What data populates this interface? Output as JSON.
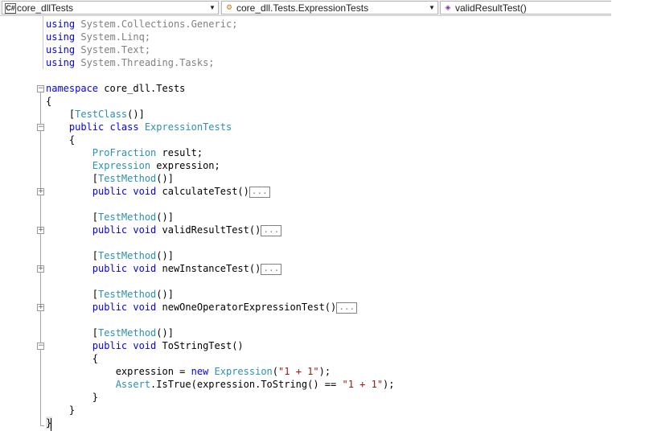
{
  "nav": {
    "project_icon": "C#",
    "project": "core_dllTests",
    "class_name": "core_dll.Tests.ExpressionTests",
    "member": "validResultTest()"
  },
  "code": {
    "using1": "using",
    "using1_ns": " System.Collections.Generic;",
    "using2": "using",
    "using2_ns": " System.Linq;",
    "using3": "using",
    "using3_ns": " System.Text;",
    "using4": "using",
    "using4_ns": " System.Threading.Tasks;",
    "namespace_kw": "namespace",
    "namespace_name": " core_dll.Tests",
    "open_brace": "{",
    "attr_testclass_open": "    [",
    "attr_testclass": "TestClass",
    "attr_testclass_close": "()]",
    "class_public": "    public",
    "class_kw": " class",
    "class_name": " ExpressionTests",
    "class_open": "    {",
    "field1_type": "        ProFraction",
    "field1_name": " result;",
    "field2_type": "        Expression",
    "field2_name": " expression;",
    "attr_open": "        [",
    "attr_testmethod": "TestMethod",
    "attr_close": "()]",
    "m_public": "        public",
    "m_void": " void",
    "m1_name": " calculateTest()",
    "m2_name": " validResultTest()",
    "m3_name": " newInstanceTest()",
    "m4_name": " newOneOperatorExpressionTest()",
    "m5_name": " ToStringTest()",
    "collapsed": "...",
    "m5_open": "        {",
    "stmt1_a": "            expression = ",
    "stmt1_new": "new",
    "stmt1_type": " Expression",
    "stmt1_b": "(",
    "stmt1_str": "\"1 + 1\"",
    "stmt1_c": ");",
    "stmt2_type": "            Assert",
    "stmt2_a": ".IsTrue(expression.ToString() == ",
    "stmt2_str": "\"1 + 1\"",
    "stmt2_c": ");",
    "m5_close": "        }",
    "class_close": "    }",
    "ns_close": "}"
  }
}
